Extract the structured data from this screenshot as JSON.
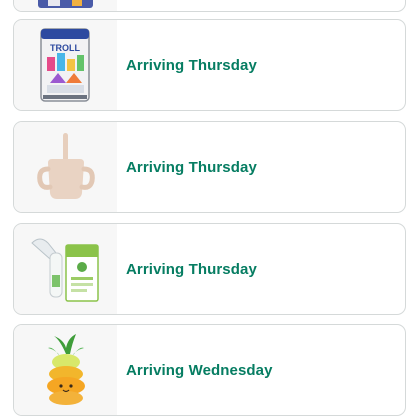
{
  "orders": {
    "items": [
      {
        "status": "",
        "product_icon": "product-image"
      },
      {
        "status": "Arriving Thursday",
        "product_icon": "building-set-box-icon"
      },
      {
        "status": "Arriving Thursday",
        "product_icon": "sippy-cup-icon"
      },
      {
        "status": "Arriving Thursday",
        "product_icon": "nasal-aspirator-icon"
      },
      {
        "status": "Arriving Wednesday",
        "product_icon": "pineapple-plush-icon"
      }
    ]
  },
  "colors": {
    "status_green": "#067d62",
    "card_border": "#d5d9d9",
    "thumb_background": "#f7f7f7"
  }
}
